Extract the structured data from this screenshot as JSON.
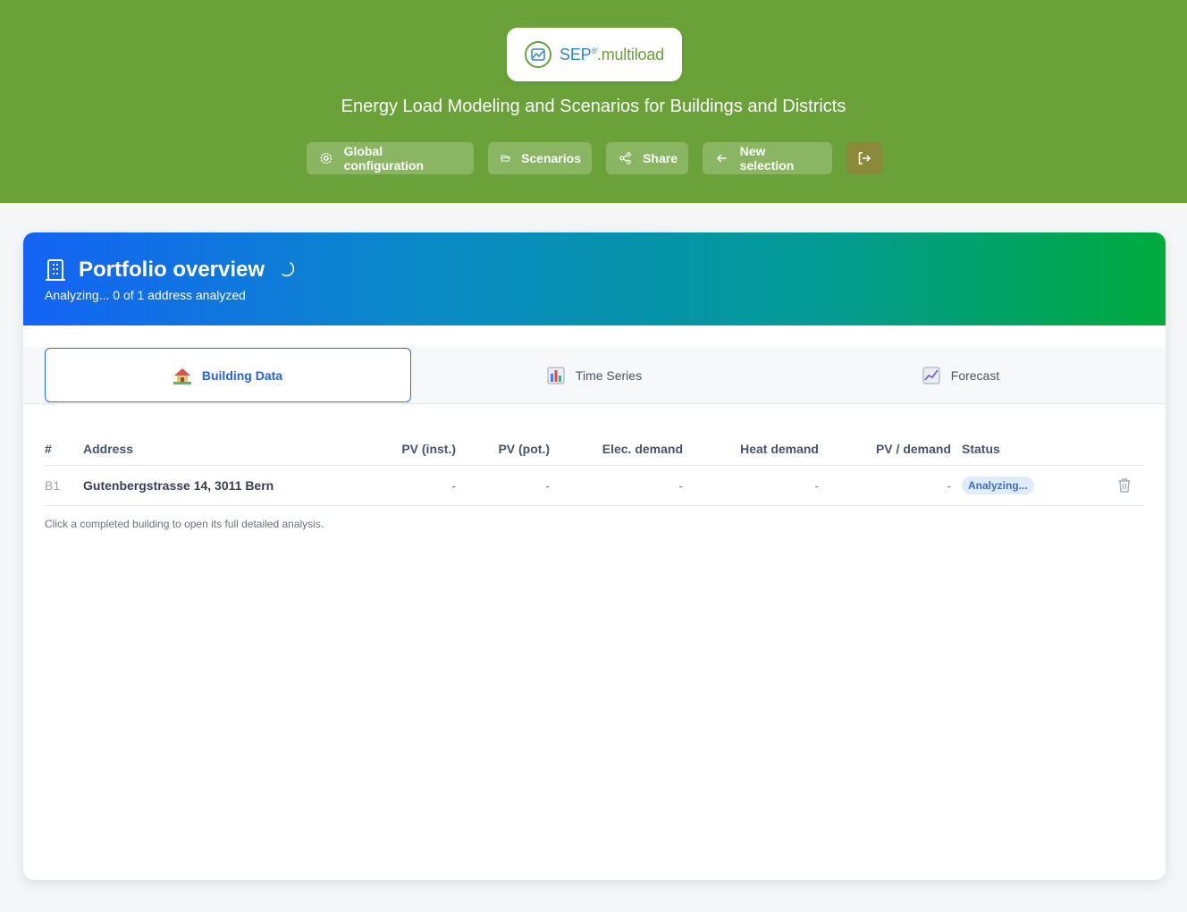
{
  "header": {
    "logo": {
      "brand": "SEP",
      "mark": "®",
      "suffix": ".multiload"
    },
    "tagline": "Energy Load Modeling and Scenarios for Buildings and Districts",
    "buttons": {
      "global_config": "Global configuration",
      "scenarios": "Scenarios",
      "share": "Share",
      "new_selection": "New selection"
    },
    "colors": {
      "background": "#6aa239",
      "exit_button": "#8a8a3a"
    }
  },
  "portfolio": {
    "title": "Portfolio overview",
    "subtitle": "Analyzing... 0 of 1 address analyzed",
    "gradient": [
      "#1463f5",
      "#00ab3c"
    ]
  },
  "tabs": [
    {
      "label": "Building Data",
      "icon": "house-icon",
      "active": true
    },
    {
      "label": "Time Series",
      "icon": "bar-chart-icon",
      "active": false
    },
    {
      "label": "Forecast",
      "icon": "trend-chart-icon",
      "active": false
    }
  ],
  "table": {
    "columns": [
      "#",
      "Address",
      "PV (inst.)",
      "PV (pot.)",
      "Elec. demand",
      "Heat demand",
      "PV / demand",
      "Status"
    ],
    "rows": [
      {
        "id": "B1",
        "address": "Gutenbergstrasse 14, 3011 Bern",
        "pv_inst": "-",
        "pv_pot": "-",
        "elec_demand": "-",
        "heat_demand": "-",
        "pv_demand": "-",
        "status": "Analyzing..."
      }
    ],
    "hint": "Click a completed building to open its full detailed analysis."
  }
}
